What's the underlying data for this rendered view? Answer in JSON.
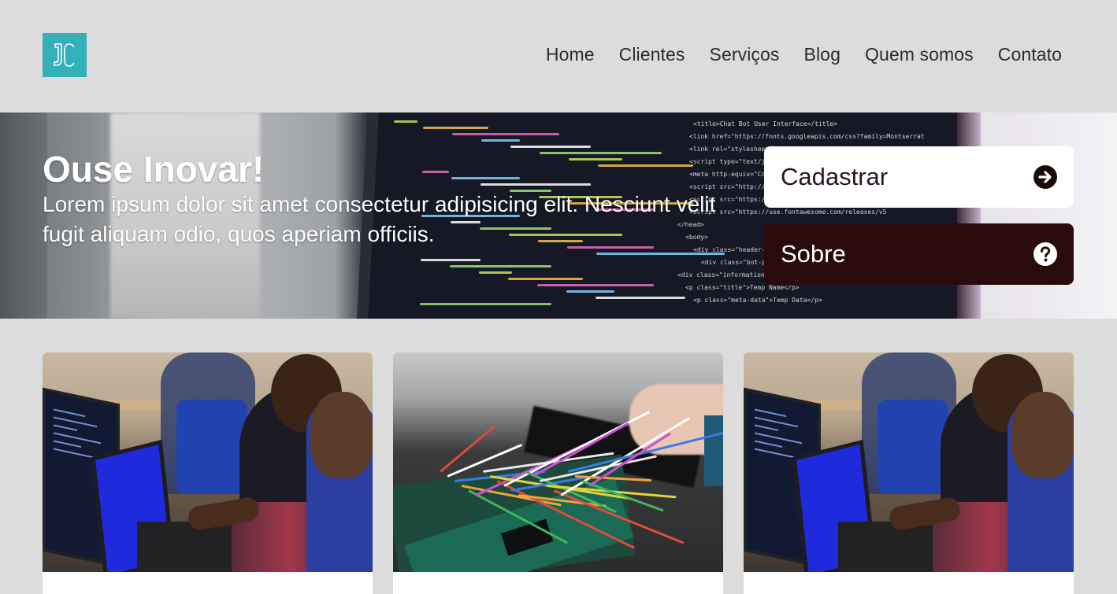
{
  "logo": {
    "text": "JC",
    "color": "#34b0b8"
  },
  "nav": {
    "items": [
      "Home",
      "Clientes",
      "Serviços",
      "Blog",
      "Quem somos",
      "Contato"
    ]
  },
  "hero": {
    "title": "Ouse Inovar!",
    "subtitle": "Lorem ipsum dolor sit amet consectetur adipisicing elit. Nesciunt velit fugit aliquam odio, quos aperiam officiis.",
    "code_lines": [
      "<title>Chat Bot User Interface</title>",
      "<link href=\"https://fonts.googleapis.com/css?family=Montserrat:400,7",
      "<link rel=\"stylesheet\"",
      "<script type=\"text/javas",
      "<meta http-equiv=\"Conten",
      "<script src=\"http://ajax",
      "<script src=\"https://www",
      "<script src=\"https://use.fontawesome.com/releases/v5",
      "</head>",
      "<body>",
      "<div class=\"header-bar\">",
      "<div class=\"bot-photo",
      "<div class=\"information\">",
      "<p class=\"title\">Temp Name</p>",
      "<p class=\"meta-data\">Temp Data</p>"
    ]
  },
  "buttons": {
    "cadastrar": {
      "label": "Cadastrar",
      "icon": "arrow-circle-right-icon"
    },
    "sobre": {
      "label": "Sobre",
      "icon": "question-circle-icon"
    }
  },
  "cards": [
    {
      "image": "people-at-computers-photo"
    },
    {
      "image": "electronics-board-photo"
    },
    {
      "image": "people-at-computers-photo"
    }
  ],
  "colors": {
    "background": "#dcdcdc",
    "accent": "#34b0b8",
    "dark_button": "#2a0b0b"
  }
}
